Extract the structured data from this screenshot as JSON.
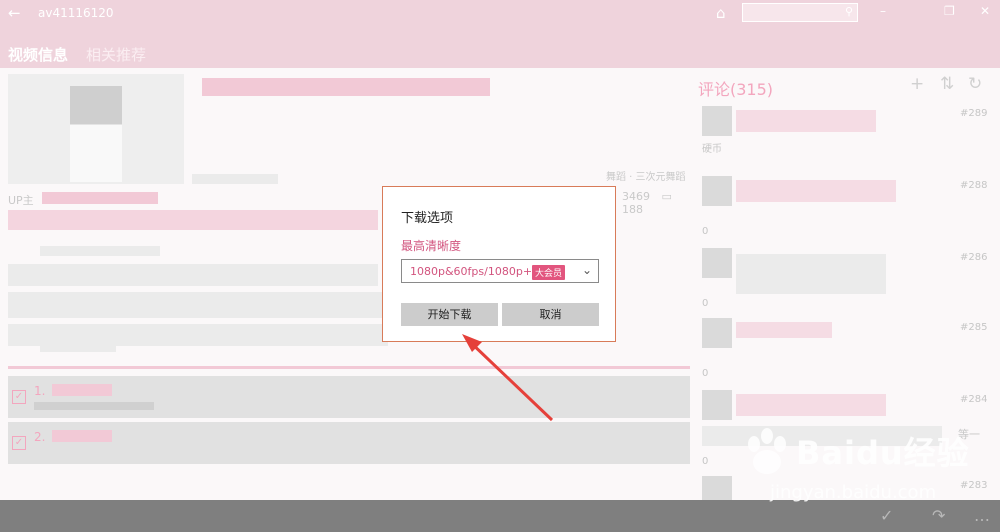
{
  "window": {
    "title": "av41116120",
    "back_glyph": "←",
    "home_glyph": "⌂",
    "search_placeholder": "",
    "search_glyph": "⚲",
    "min_glyph": "–",
    "max_glyph": "❐",
    "close_glyph": "✕"
  },
  "tabs": [
    "视频信息",
    "相关推荐"
  ],
  "video": {
    "up_label": "UP主",
    "category": "舞蹈 · 三次元舞蹈",
    "views": "3469",
    "comments": "188",
    "parts": [
      {
        "label": "1."
      },
      {
        "label": "2."
      }
    ]
  },
  "comments": {
    "title": "评论(315)",
    "add_glyph": "+",
    "sort_glyph": "⇅",
    "refresh_glyph": "↻",
    "floors": [
      "#289",
      "#288",
      "#286",
      "#285",
      "#284",
      "#283"
    ],
    "like_counts": [
      "0",
      "0",
      "0",
      "0",
      "0"
    ],
    "snippet_1": "硬币",
    "snippet_2": "等一"
  },
  "dialog": {
    "title": "下载选项",
    "quality_label": "最高清晰度",
    "selected_quality": "1080p&60fps/1080p+",
    "badge": "大会员",
    "start_button": "开始下载",
    "cancel_button": "取消"
  },
  "bottom_bar": {
    "check_glyph": "✓",
    "redo_glyph": "↷",
    "more_glyph": "…"
  },
  "watermark": {
    "brand": "Baidu经验",
    "url": "jingyan.baidu.com"
  },
  "colors": {
    "accent": "#d2547e",
    "dialog_border": "#d87b59",
    "arrow": "#e5403a"
  }
}
